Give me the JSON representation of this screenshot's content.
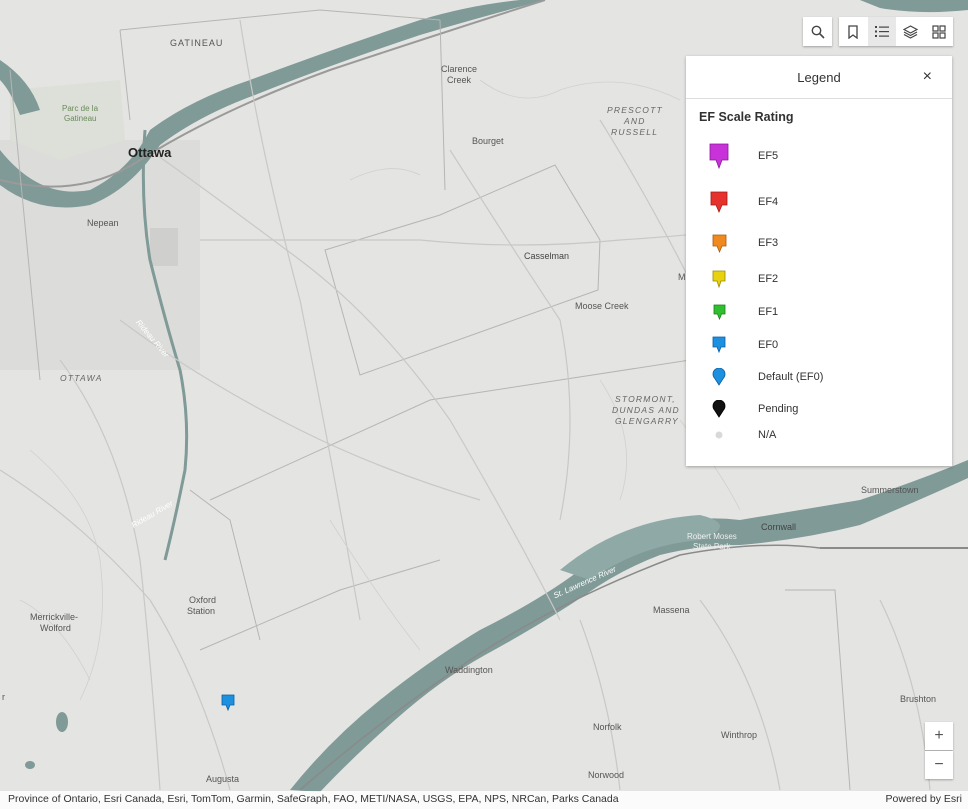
{
  "map": {
    "places": [
      {
        "id": "gatineau",
        "text": "GATINEAU"
      },
      {
        "id": "parc-la",
        "text": "Parc de la"
      },
      {
        "id": "parc-gat",
        "text": "Gatineau"
      },
      {
        "id": "ottawa",
        "text": "Ottawa"
      },
      {
        "id": "nepean",
        "text": "Nepean"
      },
      {
        "id": "ottawa-region",
        "text": "OTTAWA"
      },
      {
        "id": "clarence",
        "text": "Clarence"
      },
      {
        "id": "creek",
        "text": "Creek"
      },
      {
        "id": "prescott",
        "text": "PRESCOTT"
      },
      {
        "id": "and",
        "text": "AND"
      },
      {
        "id": "russell",
        "text": "RUSSELL"
      },
      {
        "id": "bourget",
        "text": "Bourget"
      },
      {
        "id": "casselman",
        "text": "Casselman"
      },
      {
        "id": "moose-creek",
        "text": "Moose Creek"
      },
      {
        "id": "stormont",
        "text": "STORMONT,"
      },
      {
        "id": "dundas",
        "text": "DUNDAS AND"
      },
      {
        "id": "glengarry",
        "text": "GLENGARRY"
      },
      {
        "id": "summerstown",
        "text": "Summerstown"
      },
      {
        "id": "cornwall",
        "text": "Cornwall"
      },
      {
        "id": "robert-moses",
        "text": "Robert Moses"
      },
      {
        "id": "state-park",
        "text": "State Park"
      },
      {
        "id": "massena",
        "text": "Massena"
      },
      {
        "id": "st-lawrence",
        "text": "St. Lawrence River"
      },
      {
        "id": "waddington",
        "text": "Waddington"
      },
      {
        "id": "oxford",
        "text": "Oxford"
      },
      {
        "id": "station",
        "text": "Station"
      },
      {
        "id": "merrickville",
        "text": "Merrickville-"
      },
      {
        "id": "wolford",
        "text": "Wolford"
      },
      {
        "id": "augusta",
        "text": "Augusta"
      },
      {
        "id": "norfolk",
        "text": "Norfolk"
      },
      {
        "id": "winthrop",
        "text": "Winthrop"
      },
      {
        "id": "norwood",
        "text": "Norwood"
      },
      {
        "id": "brushton",
        "text": "Brushton"
      },
      {
        "id": "rideau-river",
        "text": "Rideau River"
      },
      {
        "id": "rideau-river-2",
        "text": "Rideau River"
      },
      {
        "id": "m-cut",
        "text": "M"
      },
      {
        "id": "r-cut",
        "text": "r"
      }
    ],
    "marker": {
      "category": "EF0",
      "color": "#1e90e0"
    }
  },
  "toolbar": {
    "search_icon": "search-icon",
    "bookmark_icon": "bookmark-icon",
    "legend_icon": "legend-list-icon",
    "layers_icon": "layers-icon",
    "basemap_icon": "basemap-gallery-icon"
  },
  "legend": {
    "title": "Legend",
    "close": "×",
    "subtitle": "EF Scale Rating",
    "items": [
      {
        "label": "EF5",
        "color": "#c832d9",
        "shape": "square-pin"
      },
      {
        "label": "EF4",
        "color": "#e5322d",
        "shape": "square-pin"
      },
      {
        "label": "EF3",
        "color": "#f08a1e",
        "shape": "square-pin"
      },
      {
        "label": "EF2",
        "color": "#e8d20f",
        "shape": "square-pin"
      },
      {
        "label": "EF1",
        "color": "#2fbf2f",
        "shape": "square-pin"
      },
      {
        "label": "EF0",
        "color": "#1e90e0",
        "shape": "square-pin"
      },
      {
        "label": "Default (EF0)",
        "color": "#1e90e0",
        "shape": "round-pin"
      },
      {
        "label": "Pending",
        "color": "#111111",
        "shape": "round-pin"
      },
      {
        "label": "N/A",
        "color": "#d9d9d9",
        "shape": "dot"
      }
    ]
  },
  "zoom": {
    "in": "+",
    "out": "−"
  },
  "attribution": {
    "sources": "Province of Ontario, Esri Canada, Esri, TomTom, Garmin, SafeGraph, FAO, METI/NASA, USGS, EPA, NPS, NRCan, Parks Canada",
    "powered_by": "Powered by Esri"
  }
}
